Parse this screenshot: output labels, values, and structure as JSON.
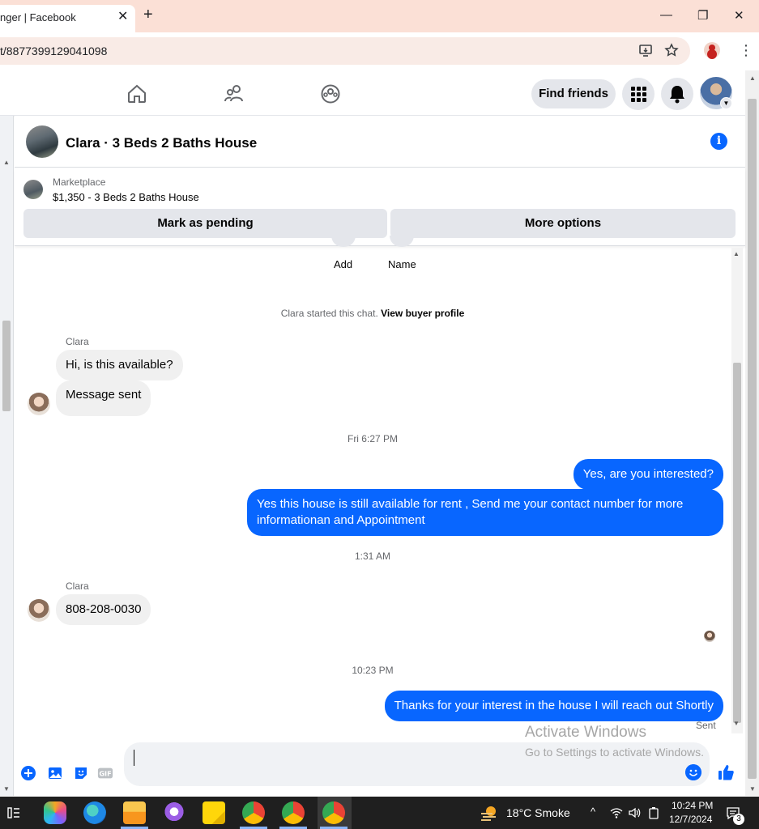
{
  "browser": {
    "tab_title": "nger | Facebook",
    "tab_close": "✕",
    "new_tab": "+",
    "url": "t/8877399129041098",
    "win_min": "—",
    "win_max": "❐",
    "win_close": "✕",
    "kebab": "⋮"
  },
  "fbnav": {
    "find_friends": "Find friends"
  },
  "chat": {
    "title": "Clara · 3 Beds 2 Baths House",
    "info_glyph": "i"
  },
  "marketplace": {
    "label": "Marketplace",
    "listing": "$1,350 - 3 Beds 2 Baths House",
    "mark_pending": "Mark as pending",
    "more_options": "More options"
  },
  "quick_actions": {
    "add": "Add",
    "name": "Name"
  },
  "conversation": {
    "started_text": "Clara started this chat.",
    "view_profile": "View buyer profile",
    "sender": "Clara",
    "msg_1": "Hi, is this available?",
    "msg_2": "Message sent",
    "time_1": "Fri 6:27 PM",
    "out_1": "Yes, are you interested?",
    "out_2": "Yes this house is still available for rent , Send me your contact number for more informationan and Appointment",
    "time_2": "1:31 AM",
    "msg_3": "808-208-0030",
    "time_3": "10:23 PM",
    "out_3": "Thanks for your interest in the house I will reach out Shortly",
    "sent_status": "Sent"
  },
  "watermark": {
    "line1": "Activate Windows",
    "line2": "Go to Settings to activate Windows."
  },
  "taskbar": {
    "weather": "18°C  Smoke",
    "time": "10:24 PM",
    "date": "12/7/2024",
    "notif_count": "3"
  },
  "colors": {
    "accent": "#0866ff",
    "bubble_in": "#f0f0f0",
    "tab_bar": "#fbe0d6"
  }
}
